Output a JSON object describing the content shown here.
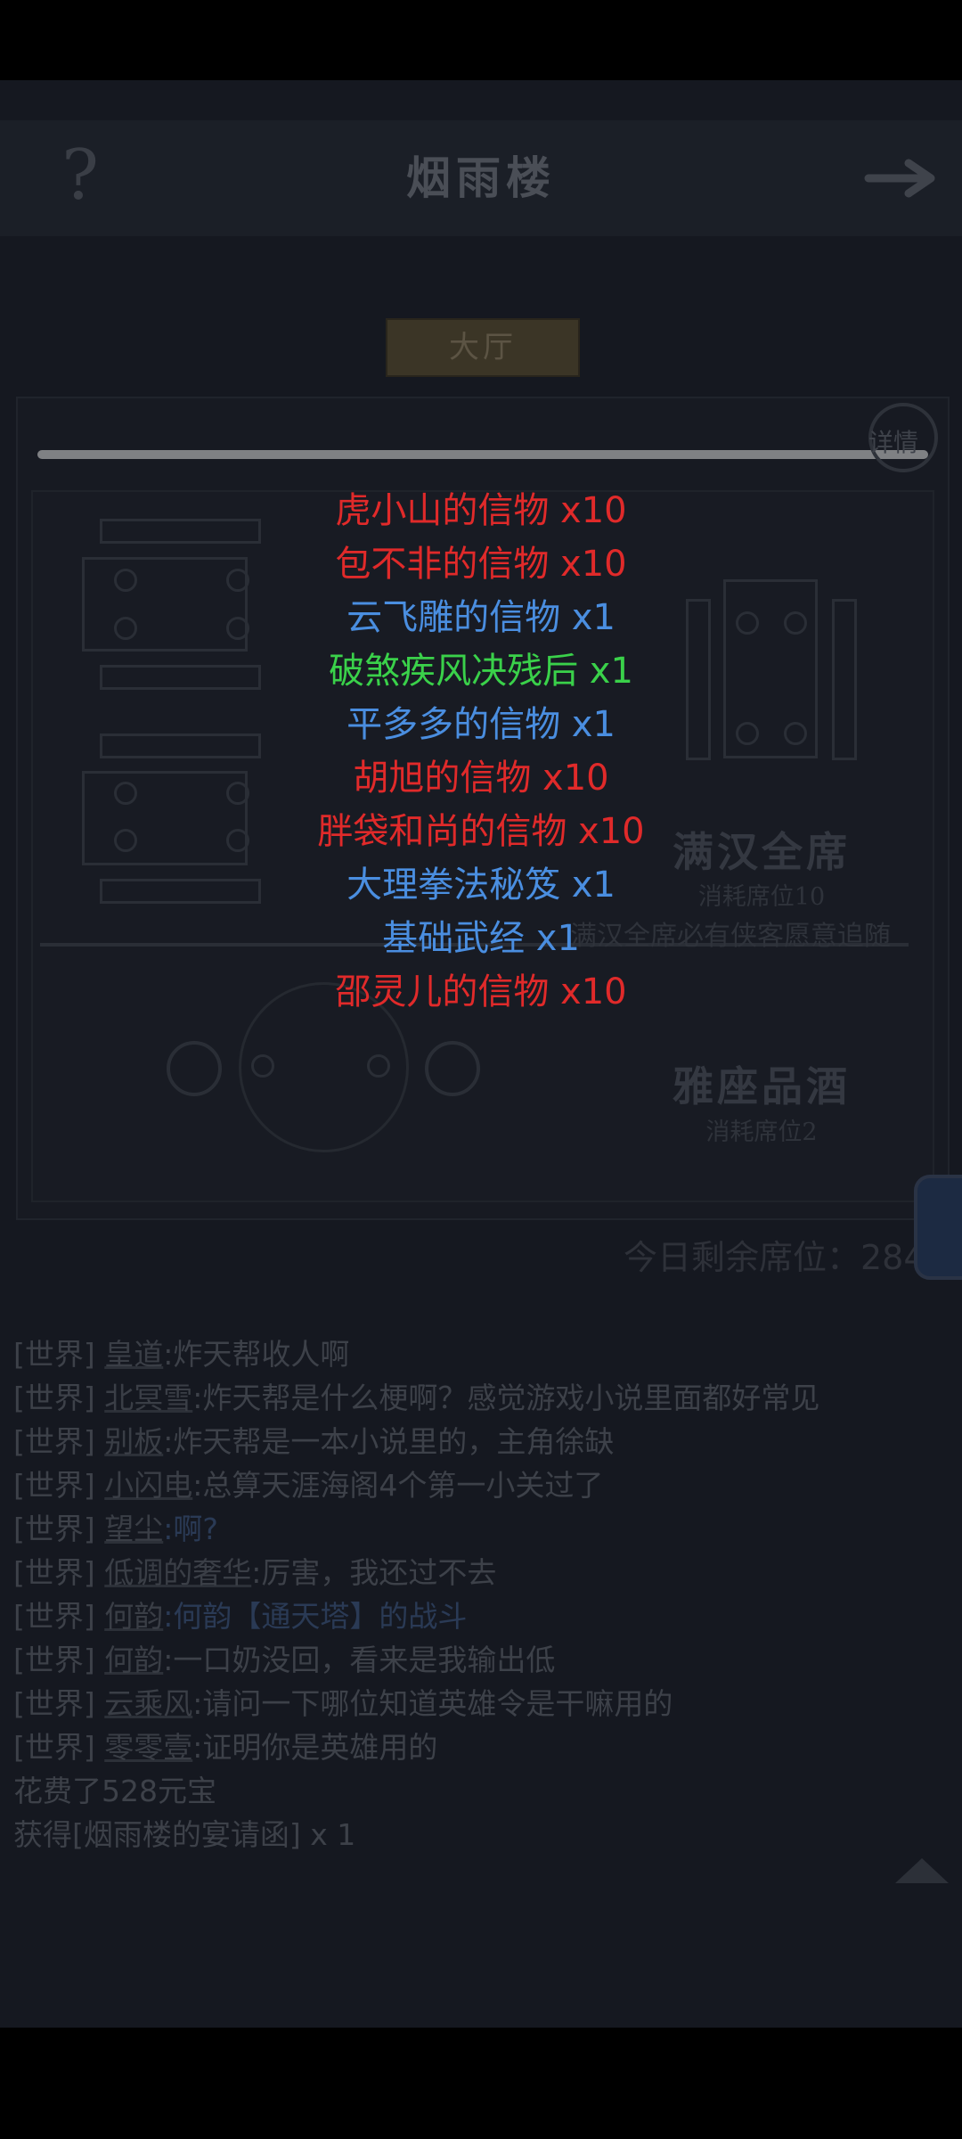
{
  "header": {
    "title": "烟雨楼",
    "help_icon": "?"
  },
  "tab": {
    "label": "大厅"
  },
  "detail_label": "详情",
  "seats": {
    "full_feast": {
      "title": "满汉全席",
      "cost": "消耗席位10",
      "note": "满汉全席必有侠客愿意追随"
    },
    "elegant": {
      "title": "雅座品酒",
      "cost": "消耗席位2"
    }
  },
  "remaining_seats": "今日剩余席位：284",
  "colors": {
    "red": "#e02a2a",
    "blue": "#4a8ee0",
    "green": "#3ad14a"
  },
  "rewards": [
    {
      "text": "虎小山的信物 x10",
      "color": "#e02a2a"
    },
    {
      "text": "包不非的信物 x10",
      "color": "#e02a2a"
    },
    {
      "text": "云飞雕的信物 x1",
      "color": "#4a8ee0"
    },
    {
      "text": "破煞疾风决残后 x1",
      "color": "#3ad14a"
    },
    {
      "text": "平多多的信物 x1",
      "color": "#4a8ee0"
    },
    {
      "text": "胡旭的信物 x10",
      "color": "#e02a2a"
    },
    {
      "text": "胖袋和尚的信物 x10",
      "color": "#e02a2a"
    },
    {
      "text": "大理拳法秘笈 x1",
      "color": "#4a8ee0"
    },
    {
      "text": "基础武经 x1",
      "color": "#4a8ee0"
    },
    {
      "text": "邵灵儿的信物 x10",
      "color": "#e02a2a"
    }
  ],
  "chat": [
    {
      "channel": "[世界]",
      "user": "皇道",
      "msg": ":炸天帮收人啊"
    },
    {
      "channel": "[世界]",
      "user": "北冥雪",
      "msg": ":炸天帮是什么梗啊？感觉游戏小说里面都好常见"
    },
    {
      "channel": "[世界]",
      "user": "别板",
      "msg": ":炸天帮是一本小说里的，主角徐缺"
    },
    {
      "channel": "[世界]",
      "user": "小闪电",
      "msg": ":总算天涯海阁4个第一小关过了"
    },
    {
      "channel": "[世界]",
      "user": "望尘",
      "msg": ":啊?"
    },
    {
      "channel": "[世界]",
      "user": "低调的奢华",
      "msg": ":厉害，我还过不去"
    },
    {
      "channel": "[世界]",
      "user": "何韵",
      "msg": ":何韵【通天塔】的战斗"
    },
    {
      "channel": "[世界]",
      "user": "何韵",
      "msg": ":一口奶没回，看来是我输出低"
    },
    {
      "channel": "[世界]",
      "user": "云乘风",
      "msg": ":请问一下哪位知道英雄令是干嘛用的"
    },
    {
      "channel": "[世界]",
      "user": "零零壹",
      "msg": ":证明你是英雄用的"
    }
  ],
  "system_msgs": [
    "花费了528元宝",
    "获得[烟雨楼的宴请函] x 1"
  ]
}
